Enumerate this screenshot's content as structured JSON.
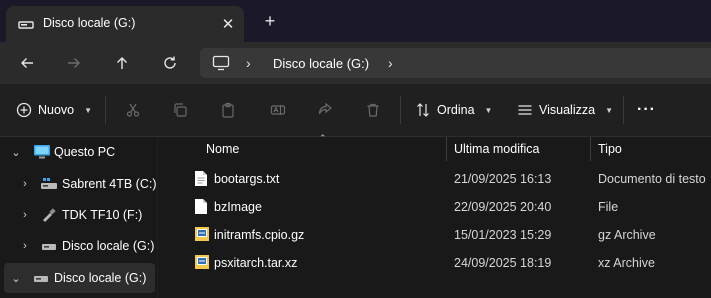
{
  "window": {
    "tab_title": "Disco locale (G:)",
    "tab_icon": "drive-icon",
    "close_glyph": "✕",
    "new_tab_glyph": "+"
  },
  "navigation": {
    "back_icon": "arrow-left-icon",
    "forward_icon": "arrow-right-icon",
    "up_icon": "arrow-up-icon",
    "refresh_icon": "refresh-icon",
    "address": {
      "root_icon": "computer-icon",
      "separator": "›",
      "crumbs": [
        "Disco locale (G:)"
      ],
      "expand": "›"
    }
  },
  "toolbar": {
    "new_label": "Nuovo",
    "sort_label": "Ordina",
    "view_label": "Visualizza",
    "more_label": "···",
    "disabled_actions": [
      "cut-icon",
      "copy-icon",
      "paste-icon",
      "rename-icon",
      "share-icon",
      "delete-icon"
    ]
  },
  "sidebar": {
    "items": [
      {
        "label": "Questo PC",
        "icon": "computer-icon",
        "expanded": true
      },
      {
        "label": "Sabrent 4TB (C:)",
        "icon": "system-drive-icon",
        "expanded": false
      },
      {
        "label": "TDK TF10 (F:)",
        "icon": "usb-drive-icon",
        "expanded": false
      },
      {
        "label": "Disco locale (G:)",
        "icon": "drive-icon",
        "expanded": false
      },
      {
        "label": "Disco locale (G:)",
        "icon": "drive-icon",
        "expanded": true,
        "selected": true
      }
    ]
  },
  "files": {
    "columns": {
      "name": "Nome",
      "modified": "Ultima modifica",
      "type": "Tipo"
    },
    "rows": [
      {
        "name": "bootargs.txt",
        "modified": "21/09/2025 16:13",
        "type": "Documento di testo",
        "icon": "text-file-icon"
      },
      {
        "name": "bzImage",
        "modified": "22/09/2025 20:40",
        "type": "File",
        "icon": "file-icon"
      },
      {
        "name": "initramfs.cpio.gz",
        "modified": "15/01/2023 15:29",
        "type": "gz Archive",
        "icon": "archive-icon"
      },
      {
        "name": "psxitarch.tar.xz",
        "modified": "24/09/2025 18:19",
        "type": "xz Archive",
        "icon": "archive-icon"
      }
    ]
  },
  "colors": {
    "accent": "#4cc2ff",
    "titlebar": "#1b1829",
    "background": "#191919"
  }
}
